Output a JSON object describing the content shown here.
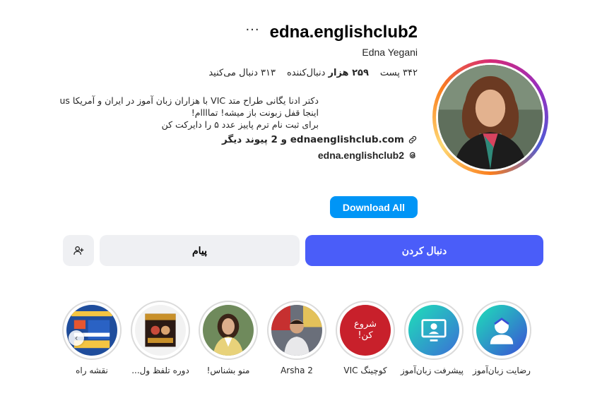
{
  "profile": {
    "username": "edna.englishclub2",
    "more_label": "···",
    "full_name": "Edna Yegani",
    "stats": {
      "posts": "۳۴۲ پست",
      "followers": "۲۵۹ هزار",
      "followers_suffix": "دنبال‌کننده",
      "following": "۳۱۳ دنبال می‌کنید"
    },
    "bio": [
      "دکتر ادنا یگانی طراح متد VIC با هزاران زبان آموز در ایران و آمریکا us",
      "اینجا قفل زبونت باز میشه! تماااام!",
      "برای ثبت نام ترم پاییز عدد ۵ را دایرکت کن"
    ],
    "link_text": "ednaenglishclub.com و 2 پیوند دیگر",
    "threads_handle": "edna.englishclub2"
  },
  "buttons": {
    "download": "Download All",
    "follow": "دنبال کردن",
    "message": "پیام"
  },
  "highlights": [
    {
      "label": "رضایت زبان‌آموز",
      "icon": "student-avatar-icon"
    },
    {
      "label": "پیشرفت زبان‌آموز",
      "icon": "monitor-user-icon"
    },
    {
      "label": "کوچینگ VIC",
      "icon": "start-badge-icon",
      "badge_text": "شروع کن!"
    },
    {
      "label": "Arsha 2",
      "icon": "photo-boy"
    },
    {
      "label": "منو بشناس!",
      "icon": "photo-woman"
    },
    {
      "label": "دوره تلفظ ول...",
      "icon": "course-box"
    },
    {
      "label": "نقشه راه",
      "icon": "roadmap-poster"
    }
  ],
  "colors": {
    "follow_bg": "#4a5df9",
    "download_bg": "#0095f6",
    "secondary_bg": "#eff0f3"
  }
}
